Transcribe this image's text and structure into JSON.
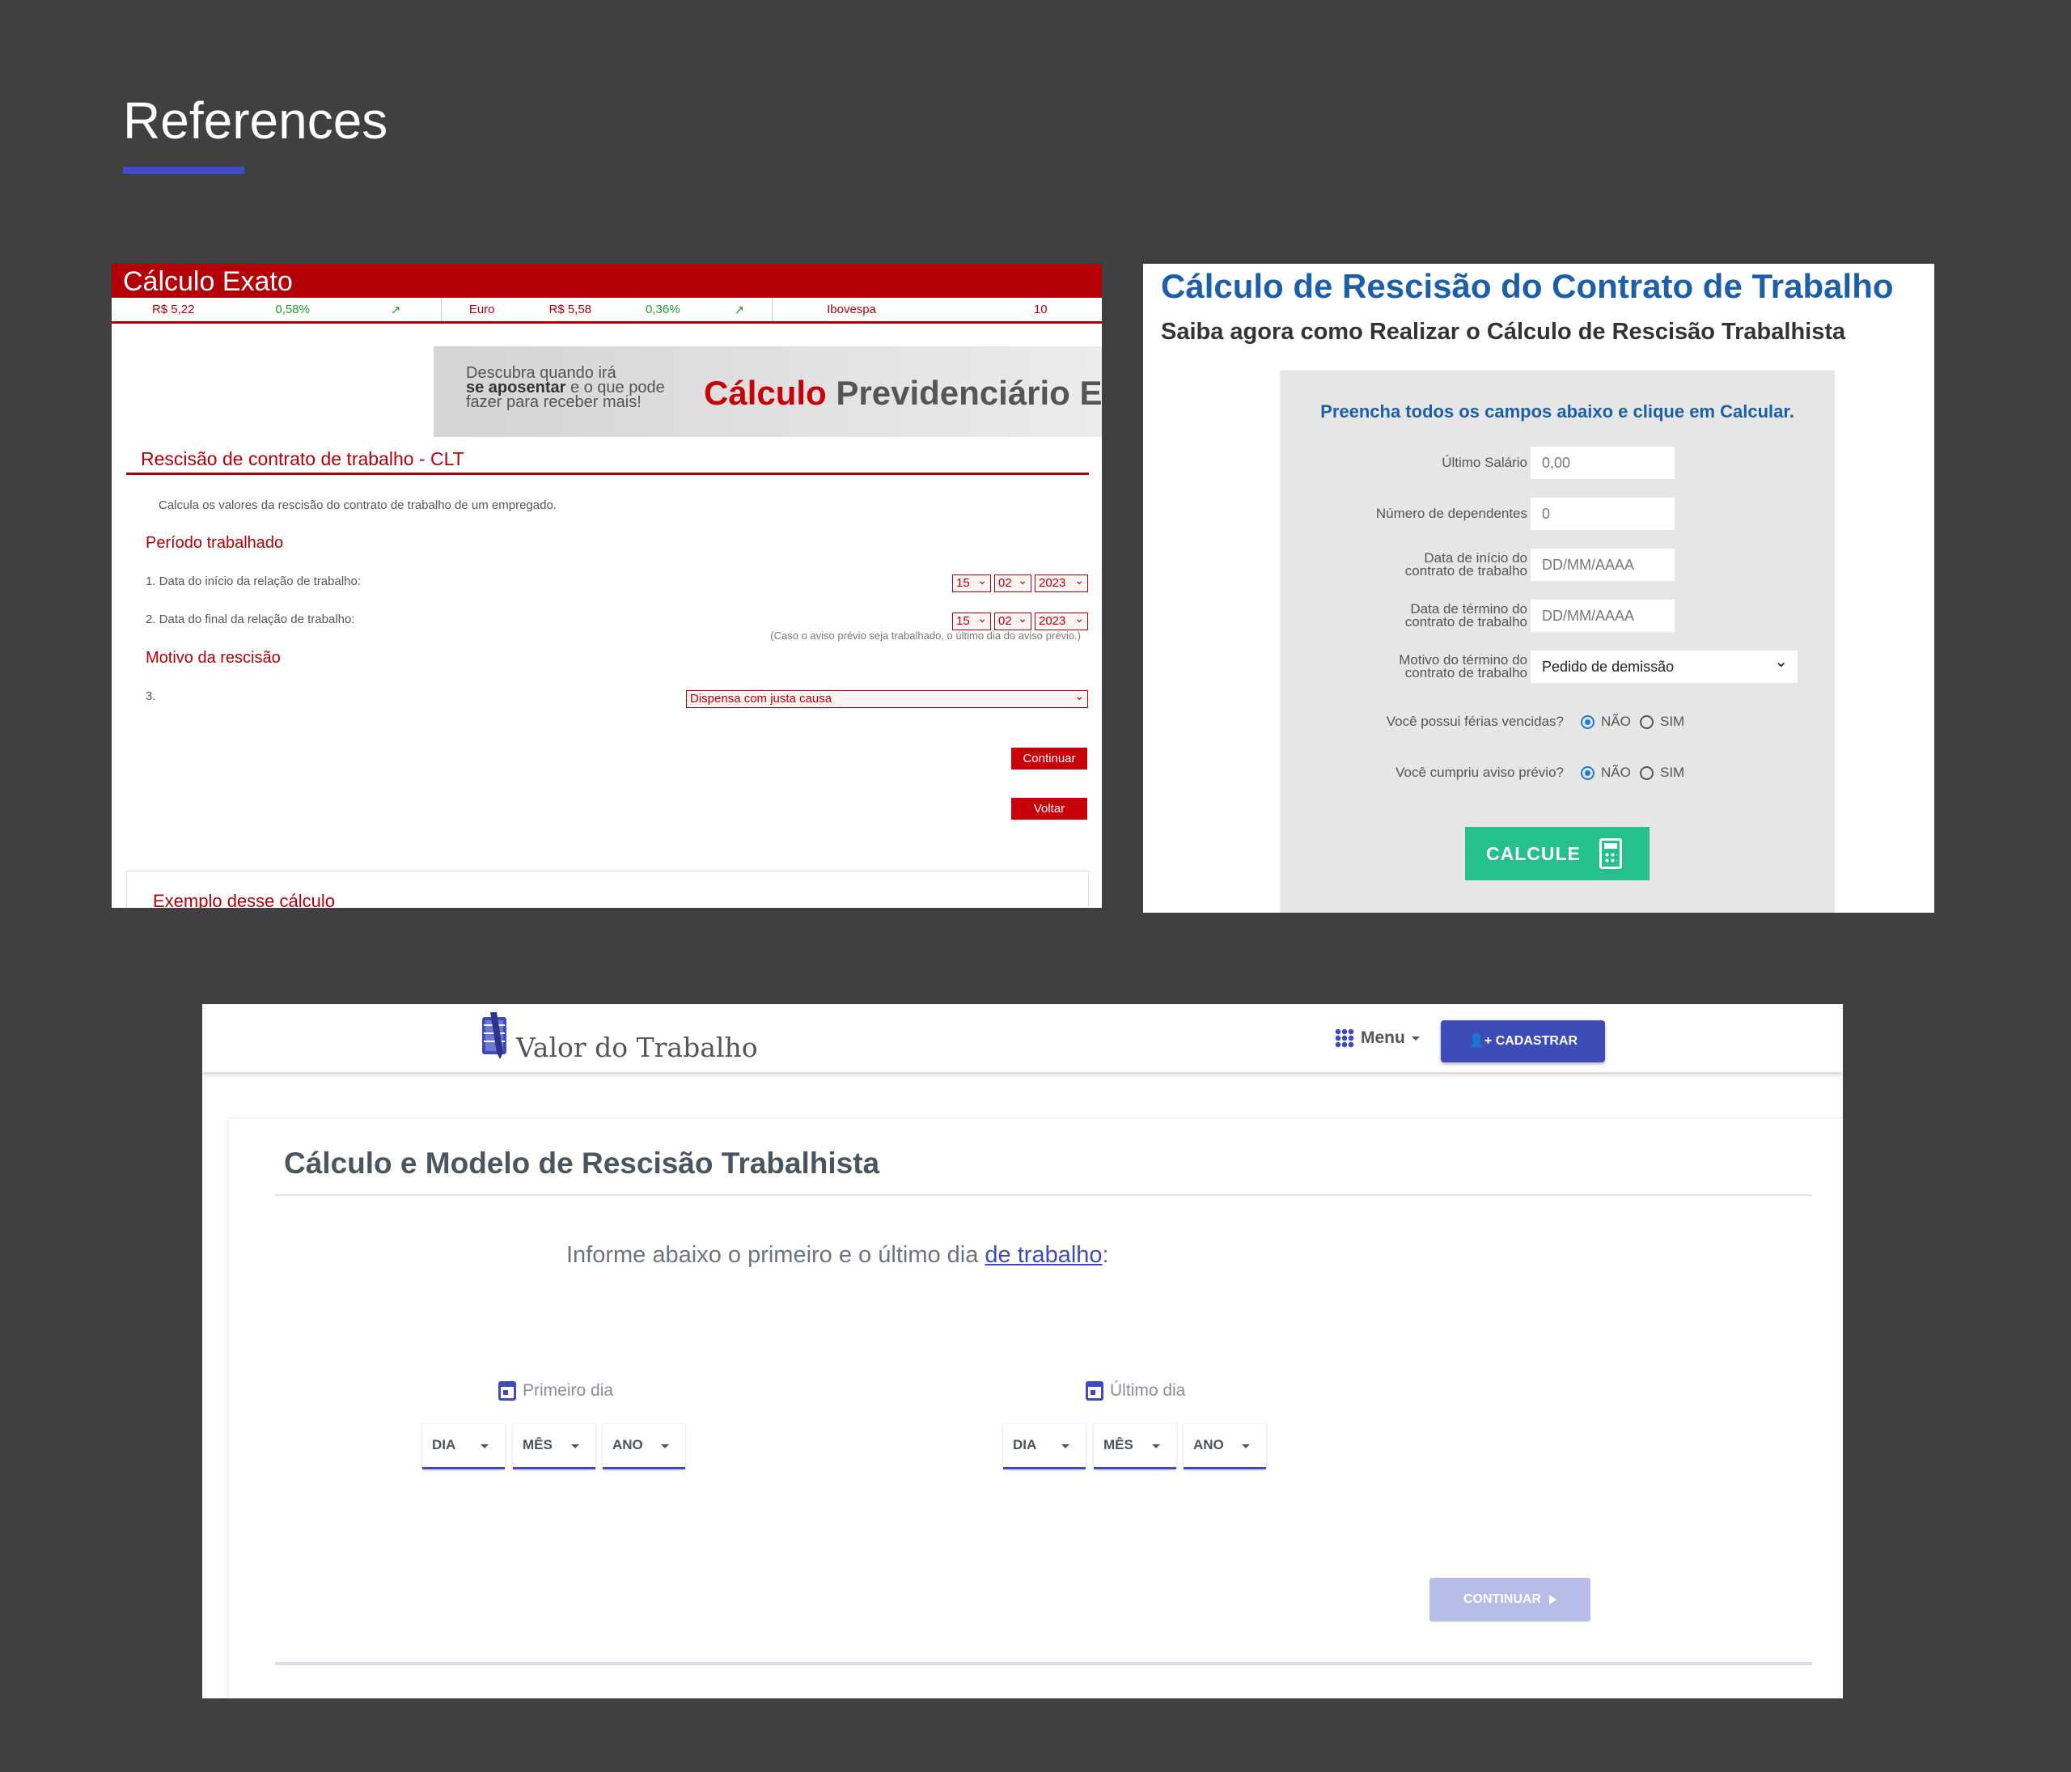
{
  "page": {
    "title": "References",
    "accent": "#3f4cc9",
    "background": "#404040"
  },
  "ref1": {
    "brand": "Cálculo Exato",
    "ticker": [
      {
        "value": "R$ 5,22",
        "change": "0,58%"
      },
      {
        "label": "Euro",
        "value": "R$ 5,58",
        "change": "0,36%"
      },
      {
        "label": "Ibovespa",
        "value": "10"
      }
    ],
    "banner": {
      "line1": "Descubra quando irá",
      "line2_bold": "se aposentar",
      "line2_rest": " e o que pode",
      "line3": "fazer para receber mais!",
      "big_red": "Cálculo",
      "big_gray": " Previdenciário E"
    },
    "section_title": "Rescisão de contrato de trabalho - CLT",
    "description": "Calcula os valores da rescisão do contrato de trabalho de um empregado.",
    "period_title": "Período trabalhado",
    "q1": "1.  Data do início da relação de trabalho:",
    "q2": "2.  Data do final da relação de trabalho:",
    "date_day": "15",
    "date_month": "02",
    "date_year": "2023",
    "note": "(Caso o aviso prévio seja trabalhado, o último dia do aviso prévio.)",
    "motive_title": "Motivo da rescisão",
    "q3": "3.",
    "motive_value": "Dispensa com justa causa",
    "continue_label": "Continuar",
    "back_label": "Voltar",
    "example_title": "Exemplo desse cálculo",
    "color": "#b30008"
  },
  "ref2": {
    "title": "Cálculo de Rescisão do Contrato de Trabalho",
    "subtitle": "Saiba agora como Realizar o Cálculo de Rescisão Trabalhista",
    "intro": "Preencha todos os campos abaixo e clique em Calcular.",
    "fields": {
      "salary_label": "Último Salário",
      "salary_value": "0,00",
      "dependents_label": "Número de dependentes",
      "dependents_value": "0",
      "start_label_1": "Data de início do",
      "start_label_2": "contrato de trabalho",
      "start_placeholder": "DD/MM/AAAA",
      "end_label_1": "Data de término do",
      "end_label_2": "contrato de trabalho",
      "end_placeholder": "DD/MM/AAAA",
      "motive_label_1": "Motivo do término do",
      "motive_label_2": "contrato de trabalho",
      "motive_value": "Pedido de demissão"
    },
    "vacation_question": "Você possui férias vencidas?",
    "notice_question": "Você cumpriu aviso prévio?",
    "no_label": "NÃO",
    "yes_label": "SIM",
    "calc_label": "CALCULE",
    "title_color": "#1d5fa6",
    "button_color": "#26c08e"
  },
  "ref3": {
    "logo_text": "Valor do Trabalho",
    "menu_label": "Menu",
    "register_label": "CADASTRAR",
    "card_title": "Cálculo e Modelo de Rescisão Trabalhista",
    "inform_text": "Informe abaixo o primeiro e o último dia ",
    "inform_link": "de trabalho",
    "inform_end": ":",
    "first_day_label": "Primeiro dia",
    "last_day_label": "Último dia",
    "day_label": "DIA",
    "month_label": "MÊS",
    "year_label": "ANO",
    "continue_label": "CONTINUAR",
    "primary_color": "#3f4cb8"
  }
}
